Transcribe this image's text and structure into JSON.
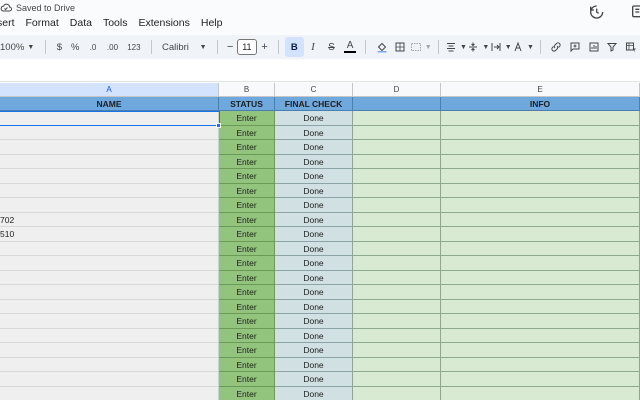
{
  "status": {
    "saved_text": "Saved to Drive"
  },
  "menu": [
    "sert",
    "Format",
    "Data",
    "Tools",
    "Extensions",
    "Help"
  ],
  "toolbar": {
    "zoom": "100%",
    "currency": "$",
    "percent": "%",
    "dec_decrease": ".0",
    "dec_increase": ".00",
    "number_format": "123",
    "font": "Calibri",
    "minus": "−",
    "font_size": "11",
    "plus": "+",
    "bold": "B",
    "italic": "I",
    "strike": "S",
    "text_color": "A"
  },
  "columns": [
    {
      "letter": "A",
      "header": "NAME"
    },
    {
      "letter": "B",
      "header": "STATUS"
    },
    {
      "letter": "C",
      "header": "FINAL CHECK"
    },
    {
      "letter": "D",
      "header": ""
    },
    {
      "letter": "E",
      "header": "INFO"
    }
  ],
  "rows": [
    {
      "a": "",
      "b": "Enter",
      "c": "Done"
    },
    {
      "a": "",
      "b": "Enter",
      "c": "Done"
    },
    {
      "a": "",
      "b": "Enter",
      "c": "Done"
    },
    {
      "a": "",
      "b": "Enter",
      "c": "Done"
    },
    {
      "a": "",
      "b": "Enter",
      "c": "Done"
    },
    {
      "a": "",
      "b": "Enter",
      "c": "Done"
    },
    {
      "a": "",
      "b": "Enter",
      "c": "Done"
    },
    {
      "a": "702",
      "b": "Enter",
      "c": "Done"
    },
    {
      "a": "510",
      "b": "Enter",
      "c": "Done"
    },
    {
      "a": "",
      "b": "Enter",
      "c": "Done"
    },
    {
      "a": "",
      "b": "Enter",
      "c": "Done"
    },
    {
      "a": "",
      "b": "Enter",
      "c": "Done"
    },
    {
      "a": "",
      "b": "Enter",
      "c": "Done"
    },
    {
      "a": "",
      "b": "Enter",
      "c": "Done"
    },
    {
      "a": "",
      "b": "Enter",
      "c": "Done"
    },
    {
      "a": "",
      "b": "Enter",
      "c": "Done"
    },
    {
      "a": "",
      "b": "Enter",
      "c": "Done"
    },
    {
      "a": "",
      "b": "Enter",
      "c": "Done"
    },
    {
      "a": "",
      "b": "Enter",
      "c": "Done"
    },
    {
      "a": "",
      "b": "Enter",
      "c": "Done"
    }
  ],
  "colors": {
    "header_blue": "#6fa8dc",
    "status_green": "#93c47d",
    "check_blue_gray": "#d0e0e3",
    "light_green": "#d9ead3",
    "name_gray": "#efefef",
    "selection": "#1a73e8"
  }
}
